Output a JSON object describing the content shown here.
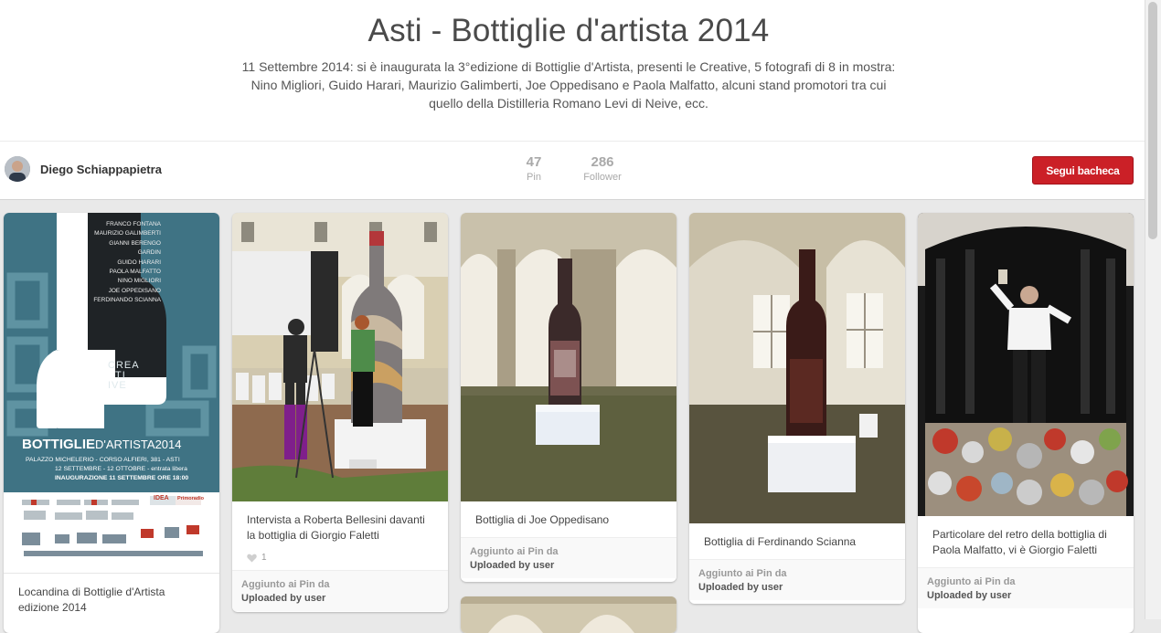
{
  "board": {
    "title": "Asti - Bottiglie d'artista 2014",
    "description": "11 Settembre 2014: si è inaugurata la 3°edizione di Bottiglie d'Artista, presenti le Creative, 5 fotografi di 8 in mostra: Nino Migliori, Guido Harari, Maurizio Galimberti, Joe Oppedisano e Paola Malfatto, alcuni stand promotori tra cui quello della Distilleria Romano Levi di Neive, ecc.",
    "owner": "Diego Schiappapietra",
    "stats": [
      {
        "value": "47",
        "label": "Pin"
      },
      {
        "value": "286",
        "label": "Follower"
      }
    ],
    "follow_label": "Segui bacheca"
  },
  "poster": {
    "names": [
      "FRANCO FONTANA",
      "MAURIZIO GALIMBERTI",
      "GIANNI BERENGO GARDIN",
      "GUIDO HARARI",
      "PAOLA MALFATTO",
      "NINO MIGLIORI",
      "JOE OPPEDISANO",
      "FERDINANDO SCIANNA"
    ],
    "creative_lines": [
      "CREA",
      "TI",
      "IVE"
    ],
    "headline_1": "BOTTIGLIE",
    "headline_2": "D'ARTISTA2014",
    "venue": "PALAZZO MICHELERIO - CORSO ALFIERI, 381 - ASTI",
    "dates": "12 SETTEMBRE - 12 OTTOBRE - entrata libera",
    "opening": "INAUGURAZIONE 11 SETTEMBRE ORE 18:00",
    "sponsor_1": "IDEA",
    "sponsor_2": "Primoradio"
  },
  "pins": [
    {
      "caption": "Locandina di Bottiglie d'Artista edizione 2014"
    },
    {
      "caption": "Intervista a Roberta Bellesini davanti la bottiglia di Giorgio Faletti",
      "likes": "1",
      "attrib_label": "Aggiunto ai Pin da",
      "attrib_source": "Uploaded by user"
    },
    {
      "caption": "Bottiglia di Joe Oppedisano",
      "attrib_label": "Aggiunto ai Pin da",
      "attrib_source": "Uploaded by user"
    },
    {
      "caption": "Bottiglia di Ferdinando Scianna",
      "attrib_label": "Aggiunto ai Pin da",
      "attrib_source": "Uploaded by user"
    },
    {
      "caption": "Particolare del retro della bottiglia di Paola Malfatto, vi è Giorgio Faletti",
      "attrib_label": "Aggiunto ai Pin da",
      "attrib_source": "Uploaded by user"
    }
  ],
  "icons": {
    "like": "heart-icon"
  },
  "colors": {
    "follow_button": "#cb2027",
    "poster_teal": "#3f7384"
  }
}
